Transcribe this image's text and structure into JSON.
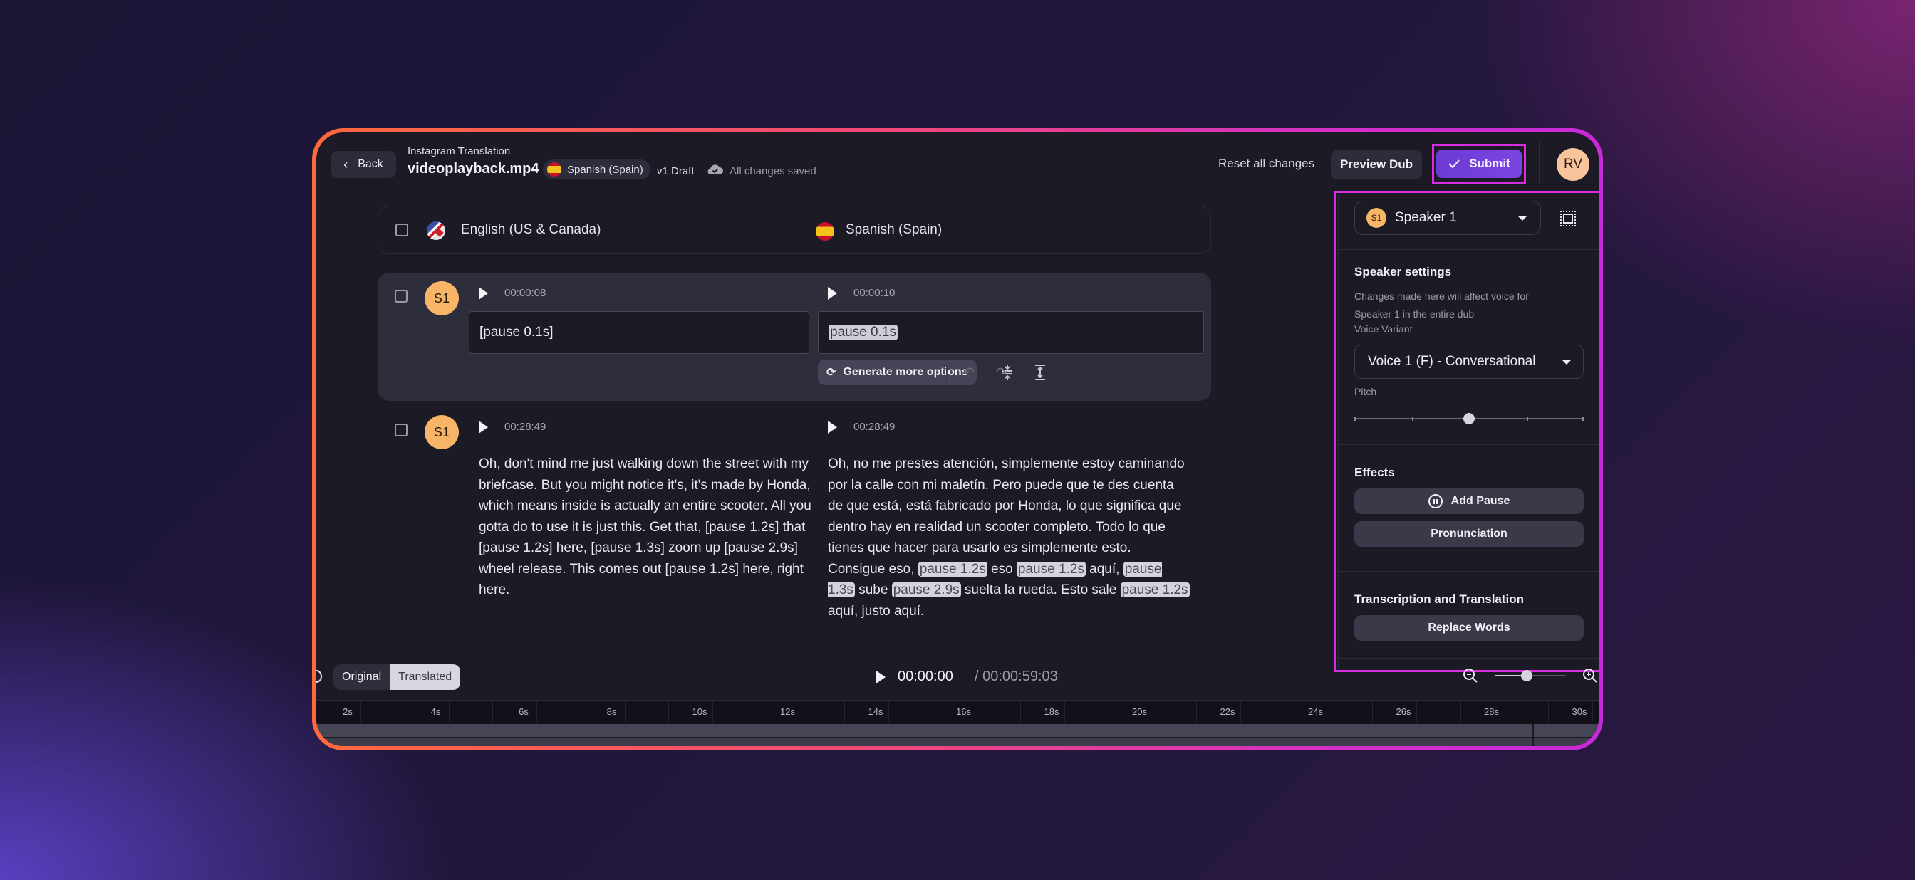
{
  "header": {
    "back_label": "Back",
    "project_label": "Instagram Translation",
    "file_name": "videoplayback.mp4",
    "target_language": "Spanish (Spain)",
    "version": "v1 Draft",
    "save_status": "All changes saved",
    "reset_label": "Reset all changes",
    "preview_label": "Preview Dub",
    "submit_label": "Submit",
    "avatar_initials": "RV"
  },
  "languages": {
    "source": "English (US & Canada)",
    "target": "Spanish (Spain)"
  },
  "segments": [
    {
      "speaker": "S1",
      "source_time": "00:00:08",
      "target_time": "00:00:10",
      "source_text": "[pause 0.1s]",
      "target_pause": "pause 0.1s",
      "generate_label": "Generate more options"
    },
    {
      "speaker": "S1",
      "source_time": "00:28:49",
      "target_time": "00:28:49",
      "source_text": "Oh, don't mind me just walking down the street with my briefcase. But you might notice it's, it's made by Honda, which means inside is actually an entire scooter. All you gotta do to use it is just this. Get that, [pause 1.2s] that [pause 1.2s] here, [pause 1.3s] zoom up [pause 2.9s] wheel release. This comes out [pause 1.2s] here, right here.",
      "target_parts": [
        {
          "text": "Oh, no me prestes atención, simplemente estoy caminando por la calle con mi maletín. Pero puede que te des cuenta de que está, está fabricado por Honda, lo que significa que dentro hay en realidad un scooter completo. Todo lo que tienes que hacer para usarlo es simplemente esto. Consigue eso, ",
          "pause": false
        },
        {
          "text": "pause 1.2s",
          "pause": true
        },
        {
          "text": " eso ",
          "pause": false
        },
        {
          "text": "pause 1.2s",
          "pause": true
        },
        {
          "text": " aquí, ",
          "pause": false
        },
        {
          "text": "pause 1.3s",
          "pause": true
        },
        {
          "text": " sube ",
          "pause": false
        },
        {
          "text": "pause 2.9s",
          "pause": true
        },
        {
          "text": " suelta la rueda. Esto sale ",
          "pause": false
        },
        {
          "text": "pause 1.2s",
          "pause": true
        },
        {
          "text": " aquí, justo aquí.",
          "pause": false
        }
      ]
    }
  ],
  "panel": {
    "speaker_badge": "S1",
    "speaker_name": "Speaker 1",
    "settings_title": "Speaker settings",
    "settings_desc": "Changes made here will affect voice for Speaker 1 in the entire dub",
    "voice_variant_label": "Voice Variant",
    "voice_variant_value": "Voice 1 (F) - Conversational",
    "pitch_label": "Pitch",
    "pitch_value_fraction": 0.5,
    "effects_title": "Effects",
    "add_pause_label": "Add Pause",
    "pronunciation_label": "Pronunciation",
    "transcription_title": "Transcription and Translation",
    "replace_words_label": "Replace Words"
  },
  "player": {
    "toggle_original": "Original",
    "toggle_translated": "Translated",
    "toggle_selected": "Translated",
    "current_time": "00:00:00",
    "total_time": "/ 00:00:59:03",
    "zoom_level_fraction": 0.45
  },
  "timeline": {
    "ticks": [
      "2s",
      "4s",
      "6s",
      "8s",
      "10s",
      "12s",
      "14s",
      "16s",
      "18s",
      "20s",
      "22s",
      "24s",
      "26s",
      "28s",
      "30s"
    ]
  },
  "colors": {
    "accent_purple": "#7040da",
    "highlight_magenta": "#d92de0",
    "speaker_badge": "#f8b467",
    "avatar": "#f7c49b"
  }
}
